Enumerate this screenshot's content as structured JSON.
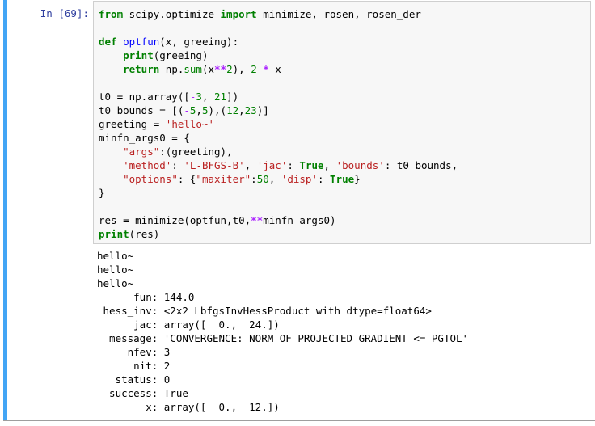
{
  "cell": {
    "type": "code",
    "selected": true,
    "execution_count": 69,
    "prompt_label": "In [69]:",
    "output_prompt_label": "",
    "select_bar_color": "#42a5f5",
    "code_background": "#f7f7f7",
    "code_border_color": "#cfcfcf",
    "prompt_color": "#303f9f"
  },
  "source": {
    "plain_text": "from scipy.optimize import minimize, rosen, rosen_der\n\ndef optfun(x, greeing):\n    print(greeing)\n    return np.sum(x**2), 2 * x\n\nt0 = np.array([-3, 21])\nt0_bounds = [(-5,5),(12,23)]\ngreeting = 'hello~'\nminfn_args0 = {\n    \"args\":(greeting),\n    'method': 'L-BFGS-B', 'jac': True, 'bounds': t0_bounds,\n    \"options\": {\"maxiter\":50, 'disp': True}\n}\n\nres = minimize(optfun,t0,**minfn_args0)\nprint(res)",
    "lines": [
      "from scipy.optimize import minimize, rosen, rosen_der",
      "",
      "def optfun(x, greeing):",
      "    print(greeing)",
      "    return np.sum(x**2), 2 * x",
      "",
      "t0 = np.array([-3, 21])",
      "t0_bounds = [(-5,5),(12,23)]",
      "greeting = 'hello~'",
      "minfn_args0 = {",
      "    \"args\":(greeting),",
      "    'method': 'L-BFGS-B', 'jac': True, 'bounds': t0_bounds,",
      "    \"options\": {\"maxiter\":50, 'disp': True}",
      "}",
      "",
      "res = minimize(optfun,t0,**minfn_args0)",
      "print(res)"
    ],
    "tokens": {
      "keywords": [
        "from",
        "import",
        "def",
        "print",
        "return"
      ],
      "keyword_constants": [
        "True"
      ],
      "builtins": [
        "sum"
      ],
      "function_name": "optfun",
      "strings": [
        "'hello~'",
        "\"args\"",
        "'method'",
        "'L-BFGS-B'",
        "'jac'",
        "'bounds'",
        "\"options\"",
        "\"maxiter\"",
        "'disp'"
      ],
      "numbers": [
        "2",
        "3",
        "21",
        "5",
        "5",
        "12",
        "23",
        "50"
      ],
      "operators": [
        "**",
        "-"
      ]
    },
    "colors": {
      "keyword": "#008000",
      "builtin": "#008000",
      "function": "#0000ff",
      "string": "#ba2121",
      "number": "#008000",
      "operator": "#aa22ff",
      "text": "#000000"
    }
  },
  "output": {
    "stream_name": "stdout",
    "plain_text": "hello~\nhello~\nhello~\n      fun: 144.0\n hess_inv: <2x2 LbfgsInvHessProduct with dtype=float64>\n      jac: array([  0.,  24.])\n  message: 'CONVERGENCE: NORM_OF_PROJECTED_GRADIENT_<=_PGTOL'\n     nfev: 3\n      nit: 2\n   status: 0\n  success: True\n        x: array([  0.,  12.])",
    "lines": [
      "hello~",
      "hello~",
      "hello~",
      "      fun: 144.0",
      " hess_inv: <2x2 LbfgsInvHessProduct with dtype=float64>",
      "      jac: array([  0.,  24.])",
      "  message: 'CONVERGENCE: NORM_OF_PROJECTED_GRADIENT_<=_PGTOL'",
      "     nfev: 3",
      "      nit: 2",
      "   status: 0",
      "  success: True",
      "        x: array([  0.,  12.])"
    ],
    "result_fields": {
      "fun": "144.0",
      "hess_inv": "<2x2 LbfgsInvHessProduct with dtype=float64>",
      "jac": "array([  0.,  24.])",
      "message": "'CONVERGENCE: NORM_OF_PROJECTED_GRADIENT_<=_PGTOL'",
      "nfev": "3",
      "nit": "2",
      "status": "0",
      "success": "True",
      "x": "array([  0.,  12.])"
    },
    "printed_greetings": [
      "hello~",
      "hello~",
      "hello~"
    ],
    "text_color": "#000000"
  }
}
